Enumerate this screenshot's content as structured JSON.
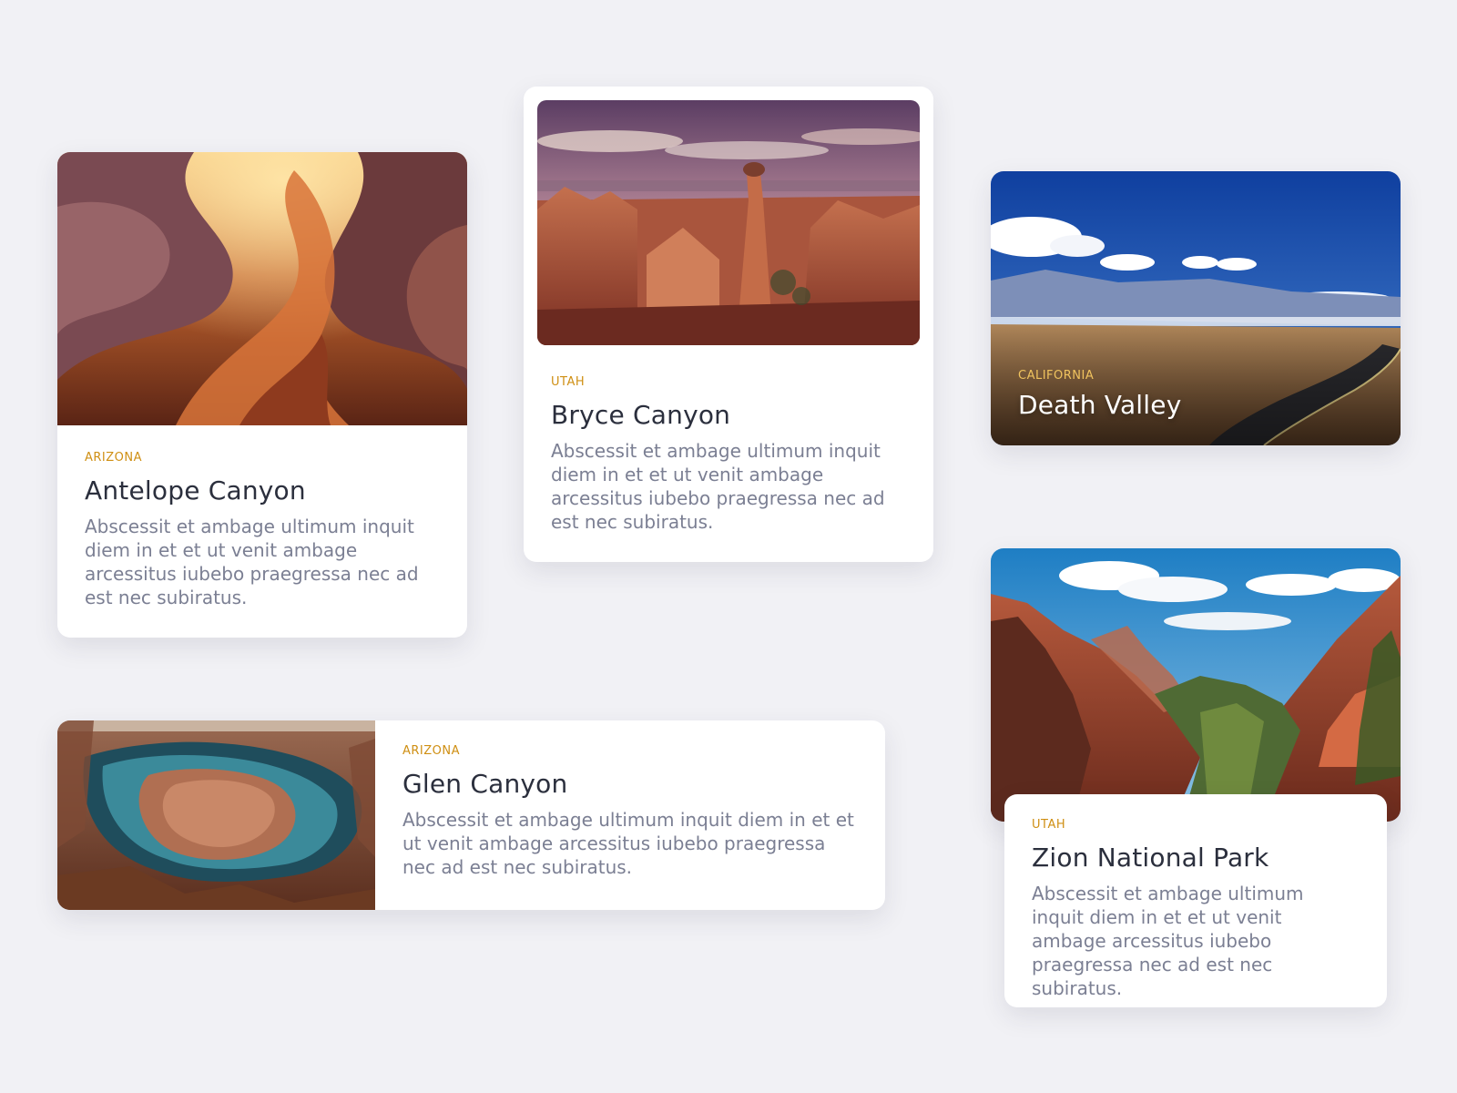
{
  "cards": [
    {
      "region": "ARIZONA",
      "title": "Antelope Canyon",
      "description": "Abscessit et ambage ultimum inquit diem in et et ut venit ambage arcessitus iubebo praegressa nec ad est nec subiratus."
    },
    {
      "region": "UTAH",
      "title": "Bryce Canyon",
      "description": "Abscessit et ambage ultimum inquit diem in et et ut venit ambage arcessitus iubebo praegressa nec ad est nec subiratus."
    },
    {
      "region": "CALIFORNIA",
      "title": "Death Valley"
    },
    {
      "region": "ARIZONA",
      "title": "Glen Canyon",
      "description": "Abscessit et ambage ultimum inquit diem in et et ut venit ambage arcessitus iubebo praegressa nec ad est nec subiratus."
    },
    {
      "region": "UTAH",
      "title": "Zion National Park",
      "description": "Abscessit et ambage ultimum inquit diem in et et ut venit ambage arcessitus iubebo praegressa nec ad est nec subiratus."
    }
  ],
  "colors": {
    "background": "#f1f1f5",
    "region_accent": "#cf8f13",
    "title": "#2b2f3d",
    "description": "#7b7f93"
  }
}
